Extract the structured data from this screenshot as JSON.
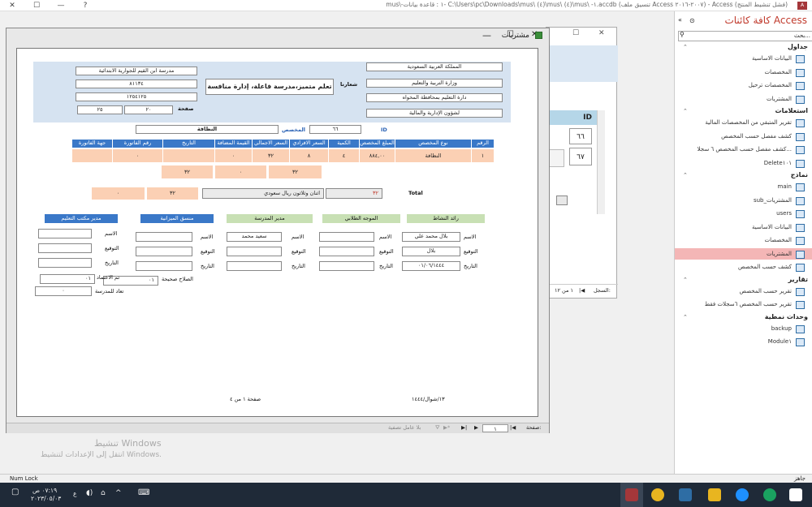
{
  "titlebar": {
    "title": "mus\\-١ : قاعدة بيانات- C:\\Users\\pc\\Downloads\\mus\\ (٤)\\mus\\ (٤)\\mus\\ -١.accdb (تنسيق ملف Access ٢٠٠٧-٢٠١٦) - Access (فشل تنشيط المنتج)",
    "min": "—",
    "max": "☐",
    "close": "✕",
    "help": "?"
  },
  "nav": {
    "title": "كافة كائنات Access",
    "search_placeholder": "بحث...",
    "sections": [
      {
        "label": "جداول",
        "items": [
          "البيانات الاساسية",
          "المخصصات",
          "المخصصات ترحيل",
          "المشتريات"
        ]
      },
      {
        "label": "استعلامات",
        "items": [
          "تقرير المتبقي من المخصصات المالية",
          "كشف مفصل حسب المخصص",
          "كشف مفصل حسب المخصص ٦ سجلا...",
          "Delete١٠١"
        ]
      },
      {
        "label": "نماذج",
        "items": [
          "main",
          "sub_المشتريات",
          "users",
          "البيانات الاساسية",
          "المخصصات",
          "المشتريات",
          "كشف حسب المخصص"
        ]
      },
      {
        "label": "تقارير",
        "items": [
          "تقرير حسب المخصص",
          "تقرير حسب المخصص ٦سجلات فقط"
        ]
      },
      {
        "label": "وحدات نمطية",
        "items": [
          "backup",
          "Module١"
        ]
      }
    ]
  },
  "bgwin": {
    "col_header": "ID",
    "row1": "٦٦",
    "row2": "٦٧",
    "record_label": "السجل:",
    "record_of": "١ من ١٢"
  },
  "win": {
    "title": "مشتريات"
  },
  "report": {
    "header_right": [
      "المملكة العربية السعودية",
      "وزارة التربية والتعليم",
      "دارة التعليم بمحافظة المخواه",
      "لشؤون الإدارية والمالية"
    ],
    "slogan_label": "شعارنا",
    "slogan": "تعلم متميز،مدرسة فاعلة، إدارة منافسة",
    "school": "مدرسة ابن القيم للجوارية الابتدائية",
    "num1": "٨١١٣٤",
    "num2": "١٢٥٤١٢٥",
    "page_label": "صفحة",
    "page_a": "٢٠",
    "page_b": "٢٥",
    "id_label": "ID",
    "id_value": "٦٦",
    "alloc_label": "المخصص",
    "alloc_value": "النظافة",
    "columns": [
      "الرقم",
      "نوع المخصص",
      "المبلغ المخصص",
      "الكمية",
      "السعر الافرادي",
      "السعر الاجمالي",
      "القيمة المضافة",
      "التاريخ",
      "رقم الفاتورة",
      "جهة الفاتورة"
    ],
    "row": [
      "١",
      "النظافة",
      "٨٨٤,٠٠",
      "٤",
      "٨",
      "٣٢",
      "٠",
      "",
      "٠",
      ""
    ],
    "sub_totals": [
      "٣٢",
      "٠",
      "٣٢"
    ],
    "total_label": "Total",
    "total_words": "اثنان وثلاثون ريال سعودي",
    "total_value": "٣٢",
    "total_a": "٣٢",
    "total_b": "٠",
    "sig_headers": [
      "رائد النشاط",
      "الموجه الطلابي",
      "مدير المدرسة",
      "منسق الميزانية",
      "مدير مكتب التعليم"
    ],
    "name_label": "الاسم",
    "sign_label": "التوقيع",
    "date_label": "التاريخ",
    "col1_name": "بلال محمد علي",
    "col1_sign": "بلال",
    "col1_date": "٠١/٠٦/١٤٤٤",
    "col3_name": "سعيد محمد",
    "validity_label": "الصلاح صحيحة",
    "validity_value": "٠١",
    "approve_label": "تم الاعتماد",
    "approve_value": "٠١",
    "school_label": "تعاد للمدرسة",
    "school_value": "٠",
    "footer_page": "صفحة ١ من ٤",
    "footer_date": "١٣/شوال/١٤٤٤"
  },
  "win_status": {
    "page_label": "صفحة:",
    "page_value": "١",
    "filter": "بلا عامل تصفية"
  },
  "activation": {
    "line1": "تنشيط Windows",
    "line2": "انتقل إلى الإعدادات لتنشيط Windows."
  },
  "statusbar": {
    "left": "Num Lock",
    "right": "جاهز"
  },
  "taskbar": {
    "time": "٠٧:١٩ ص",
    "date": "٢٠٢٣/٠٥/٠٣",
    "lang": "ع"
  },
  "colors": {
    "nav_title": "#c0392b",
    "header_blue": "#3a78c8",
    "peach": "#fbd0b4",
    "green": "#c8e0b4",
    "selected": "#f4b6b6"
  }
}
